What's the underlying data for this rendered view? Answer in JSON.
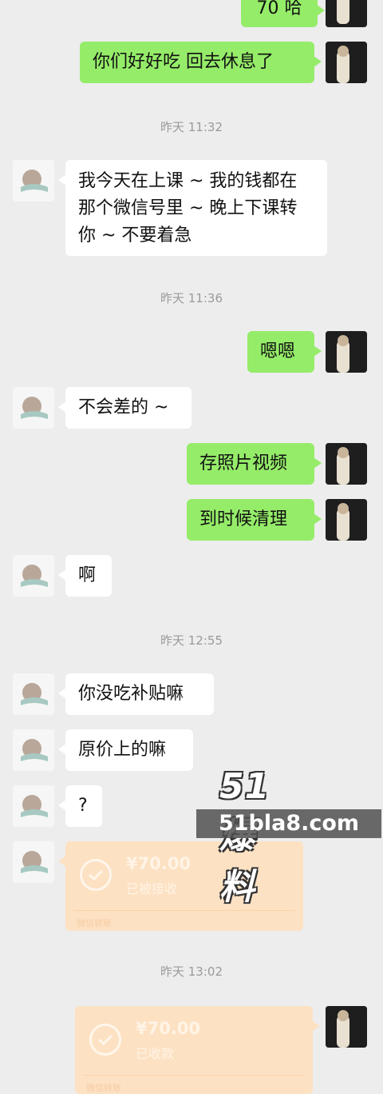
{
  "messages": {
    "m1": "70 哈",
    "m2": "你们好好吃 回去休息了",
    "m3_l1": "我今天在上课 ~ 我的钱都在",
    "m3_l2": "那个微信号里 ~ 晚上下课转",
    "m3_l3": "你 ~ 不要着急",
    "m4": "嗯嗯",
    "m5": "不会差的 ~",
    "m6": "存照片视频",
    "m7": "到时候清理",
    "m8": "啊",
    "m9": "你没吃补贴嘛",
    "m10": "原价上的嘛",
    "m11": "?"
  },
  "timestamps": {
    "t1": "昨天 11:32",
    "t2": "昨天 11:36",
    "t3": "昨天 12:55",
    "t4": "昨天 13:02"
  },
  "transfers": {
    "left": {
      "amount": "¥70.00",
      "status": "已被接收",
      "label": "微信转账"
    },
    "right": {
      "amount": "¥70.00",
      "status": "已收款",
      "label": "微信转账"
    }
  },
  "watermark": {
    "top": "51爆料",
    "bottom": "51bla8.com"
  },
  "colors": {
    "background": "#ededed",
    "self_bubble": "#95ec69",
    "other_bubble": "#ffffff",
    "transfer": "#fde1c3"
  }
}
